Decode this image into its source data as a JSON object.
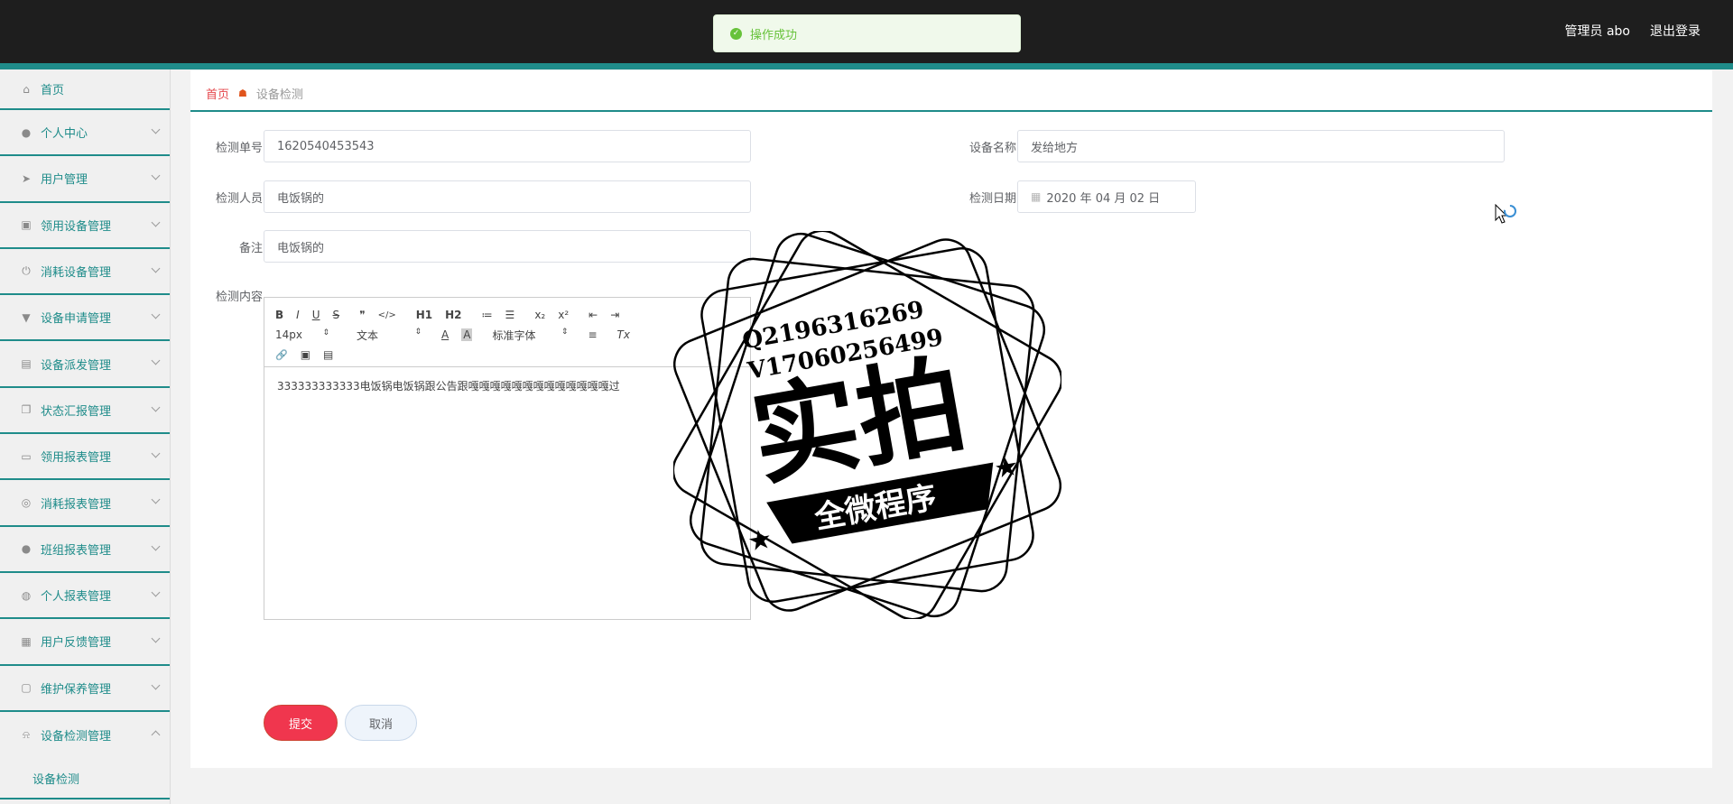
{
  "toast": {
    "message": "操作成功"
  },
  "header": {
    "user_label": "管理员 abo",
    "logout_label": "退出登录"
  },
  "sidebar": {
    "items": [
      {
        "label": "首页",
        "icon": "home-icon",
        "glyph": "⌂"
      },
      {
        "label": "个人中心",
        "icon": "user-icon",
        "glyph": "●"
      },
      {
        "label": "用户管理",
        "icon": "send-icon",
        "glyph": "➤"
      },
      {
        "label": "领用设备管理",
        "icon": "chart-icon",
        "glyph": "▣"
      },
      {
        "label": "消耗设备管理",
        "icon": "power-icon",
        "glyph": "⏻"
      },
      {
        "label": "设备申请管理",
        "icon": "brush-icon",
        "glyph": "▼"
      },
      {
        "label": "设备派发管理",
        "icon": "printer-icon",
        "glyph": "▤"
      },
      {
        "label": "状态汇报管理",
        "icon": "copy-icon",
        "glyph": "❐"
      },
      {
        "label": "领用报表管理",
        "icon": "image-icon",
        "glyph": "▭"
      },
      {
        "label": "消耗报表管理",
        "icon": "target-icon",
        "glyph": "◎"
      },
      {
        "label": "班组报表管理",
        "icon": "user-icon",
        "glyph": "●"
      },
      {
        "label": "个人报表管理",
        "icon": "compass-icon",
        "glyph": "◍"
      },
      {
        "label": "用户反馈管理",
        "icon": "clipboard-icon",
        "glyph": "▦"
      },
      {
        "label": "维护保养管理",
        "icon": "chat-icon",
        "glyph": "▢"
      },
      {
        "label": "设备检测管理",
        "icon": "bell-icon",
        "glyph": "⍾"
      }
    ],
    "sub_item": "设备检测"
  },
  "breadcrumb": {
    "home": "首页",
    "current": "设备检测"
  },
  "form": {
    "order_no_label": "检测单号",
    "order_no_value": "1620540453543",
    "device_name_label": "设备名称",
    "device_name_value": "发给地方",
    "inspector_label": "检测人员",
    "inspector_value": "电饭锅的",
    "date_label": "检测日期",
    "date_value": "2020 年 04 月 02 日",
    "remark_label": "备注",
    "remark_value": "电饭锅的",
    "content_label": "检测内容",
    "content_value": "333333333333电饭锅电饭锅跟公告跟嘎嘎嘎嘎嘎嘎嘎嘎嘎嘎嘎嘎嘎过"
  },
  "editor_toolbar": {
    "bold": "B",
    "italic": "I",
    "underline": "U",
    "strike": "S",
    "quote": "❞",
    "code": "</>",
    "h1": "H1",
    "h2": "H2",
    "ordered_list": "≔",
    "bullet_list": "☰",
    "subscript": "x₂",
    "superscript": "x²",
    "outdent": "⇤",
    "indent": "⇥",
    "font_size": "14px",
    "text_type": "文本",
    "font_color": "A",
    "bg_color": "A",
    "font_family": "标准字体",
    "align": "≡",
    "clear": "Tx",
    "link": "🔗",
    "image": "▣",
    "video": "▤"
  },
  "buttons": {
    "submit": "提交",
    "cancel": "取消"
  },
  "stamp": {
    "line1": "Q2196316269",
    "line2": "V17060256499",
    "big": "实拍",
    "banner": "全微程序"
  }
}
